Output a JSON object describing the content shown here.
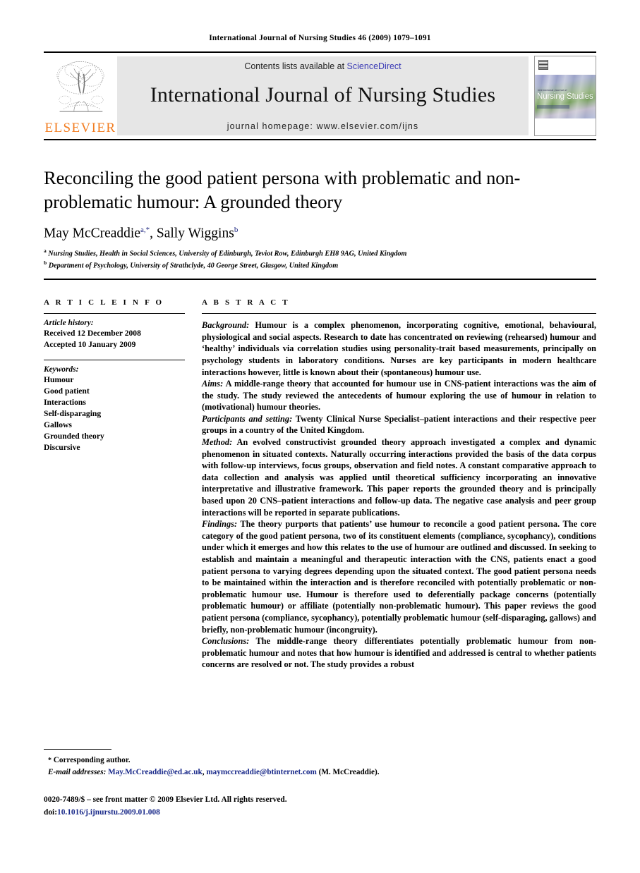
{
  "running_head": "International Journal of Nursing Studies 46 (2009) 1079–1091",
  "masthead": {
    "publisher_name": "ELSEVIER",
    "contents_prefix": "Contents lists available at ",
    "contents_link": "ScienceDirect",
    "journal_title": "International Journal of Nursing Studies",
    "homepage": "journal homepage: www.elsevier.com/ijns",
    "cover_title": "Nursing Studies",
    "cover_superlabel": "International Journal of",
    "link_color": "#3b3bb5"
  },
  "article": {
    "title": "Reconciling the good patient persona with problematic and non-problematic humour: A grounded theory",
    "authors": [
      {
        "name": "May McCreaddie",
        "marks": "a,*"
      },
      {
        "name": "Sally Wiggins",
        "marks": "b"
      }
    ],
    "affiliations": [
      {
        "mark": "a",
        "text": "Nursing Studies, Health in Social Sciences, University of Edinburgh, Teviot Row, Edinburgh EH8 9AG, United Kingdom"
      },
      {
        "mark": "b",
        "text": "Department of Psychology, University of Strathclyde, 40 George Street, Glasgow, United Kingdom"
      }
    ]
  },
  "article_info": {
    "heading": "A R T I C L E  I N F O",
    "history_label": "Article history:",
    "history": [
      "Received 12 December 2008",
      "Accepted 10 January 2009"
    ],
    "keywords_label": "Keywords:",
    "keywords": [
      "Humour",
      "Good patient",
      "Interactions",
      "Self-disparaging",
      "Gallows",
      "Grounded theory",
      "Discursive"
    ]
  },
  "abstract": {
    "heading": "A B S T R A C T",
    "sections": [
      {
        "label": "Background:",
        "text": " Humour is a complex phenomenon, incorporating cognitive, emotional, behavioural, physiological and social aspects. Research to date has concentrated on reviewing (rehearsed) humour and ‘healthy’ individuals via correlation studies using personality-trait based measurements, principally on psychology students in laboratory conditions. Nurses are key participants in modern healthcare interactions however, little is known about their (spontaneous) humour use."
      },
      {
        "label": "Aims:",
        "text": " A middle-range theory that accounted for humour use in CNS-patient interactions was the aim of the study. The study reviewed the antecedents of humour exploring the use of humour in relation to (motivational) humour theories."
      },
      {
        "label": "Participants and setting:",
        "text": " Twenty Clinical Nurse Specialist–patient interactions and their respective peer groups in a country of the United Kingdom."
      },
      {
        "label": "Method:",
        "text": " An evolved constructivist grounded theory approach investigated a complex and dynamic phenomenon in situated contexts. Naturally occurring interactions provided the basis of the data corpus with follow-up interviews, focus groups, observation and field notes. A constant comparative approach to data collection and analysis was applied until theoretical sufficiency incorporating an innovative interpretative and illustrative framework. This paper reports the grounded theory and is principally based upon 20 CNS–patient interactions and follow-up data. The negative case analysis and peer group interactions will be reported in separate publications."
      },
      {
        "label": "Findings:",
        "text": " The theory purports that patients’ use humour to reconcile a good patient persona. The core category of the good patient persona, two of its constituent elements (compliance, sycophancy), conditions under which it emerges and how this relates to the use of humour are outlined and discussed. In seeking to establish and maintain a meaningful and therapeutic interaction with the CNS, patients enact a good patient persona to varying degrees depending upon the situated context. The good patient persona needs to be maintained within the interaction and is therefore reconciled with potentially problematic or non-problematic humour use. Humour is therefore used to deferentially package concerns (potentially problematic humour) or affiliate (potentially non-problematic humour). This paper reviews the good patient persona (compliance, sycophancy), potentially problematic humour (self-disparaging, gallows) and briefly, non-problematic humour (incongruity)."
      },
      {
        "label": "Conclusions:",
        "text": " The middle-range theory differentiates potentially problematic humour from non-problematic humour and notes that how humour is identified and addressed is central to whether patients concerns are resolved or not. The study provides a robust"
      }
    ]
  },
  "footnotes": {
    "corresponding_marker": "*",
    "corresponding_text": "Corresponding author.",
    "email_label": "E-mail addresses:",
    "email_1": "May.McCreaddie@ed.ac.uk",
    "email_sep": ", ",
    "email_2": "maymccreaddie@btinternet.com",
    "email_suffix": " (M. McCreaddie)."
  },
  "colophon": {
    "front_matter": "0020-7489/$ – see front matter © 2009 Elsevier Ltd. All rights reserved.",
    "doi_label": "doi:",
    "doi_value": "10.1016/j.ijnurstu.2009.01.008"
  }
}
